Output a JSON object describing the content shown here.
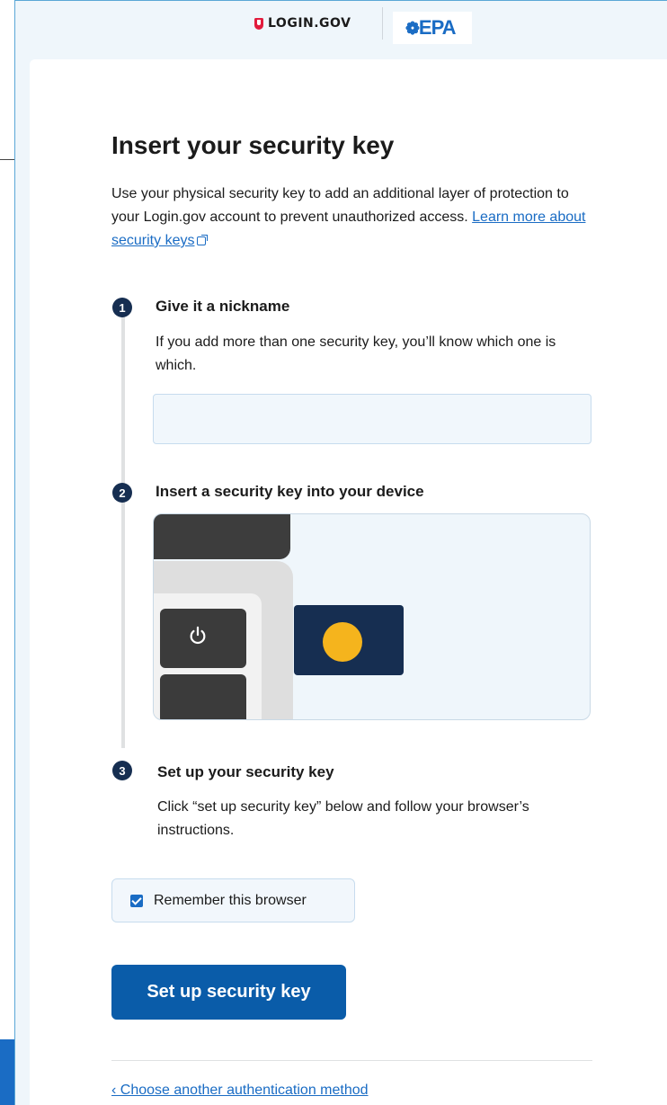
{
  "header": {
    "login_logo": "LOGIN.GOV",
    "partner_logo": "EPA"
  },
  "page": {
    "title": "Insert your security key",
    "intro_text": "Use your physical security key to add an additional layer of protection to your Login.gov account to prevent unauthorized access.",
    "learn_more_link": "Learn more about security keys"
  },
  "steps": [
    {
      "number": "1",
      "title": "Give it a nickname",
      "text": "If you add more than one security key, you’ll know which one is which.",
      "input_value": ""
    },
    {
      "number": "2",
      "title": "Insert a security key into your device"
    },
    {
      "number": "3",
      "title": "Set up your security key",
      "text": "Click “set up security key” below and follow your browser’s instructions."
    }
  ],
  "remember_browser": {
    "label": "Remember this browser",
    "checked": true
  },
  "actions": {
    "primary_button": "Set up security key",
    "back_link": "‹ Choose another authentication method"
  },
  "colors": {
    "accent": "#1a6cc4",
    "primary_button": "#0a5ca9",
    "step_badge": "#162e51",
    "key_light": "#f5b41d"
  }
}
